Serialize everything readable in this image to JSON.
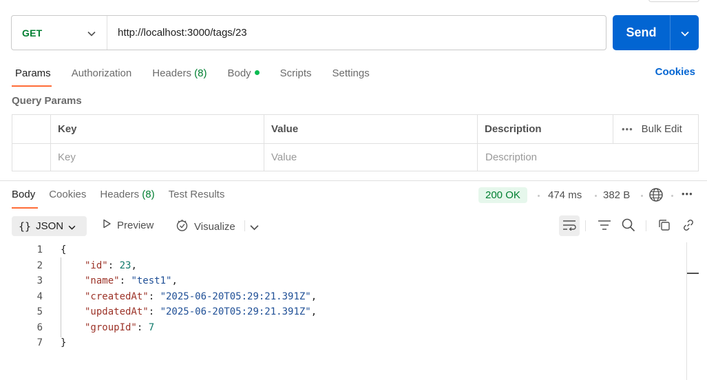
{
  "request": {
    "method": "GET",
    "url": "http://localhost:3000/tags/23",
    "send_label": "Send"
  },
  "request_tabs": {
    "params": "Params",
    "authorization": "Authorization",
    "headers": "Headers",
    "headers_count": "(8)",
    "body": "Body",
    "scripts": "Scripts",
    "settings": "Settings",
    "cookies": "Cookies"
  },
  "query_params": {
    "title": "Query Params",
    "columns": [
      "Key",
      "Value",
      "Description"
    ],
    "bulk_edit": "Bulk Edit",
    "placeholders": {
      "key": "Key",
      "value": "Value",
      "description": "Description"
    }
  },
  "response_tabs": {
    "body": "Body",
    "cookies": "Cookies",
    "headers": "Headers",
    "headers_count": "(8)",
    "test_results": "Test Results"
  },
  "response_meta": {
    "status": "200 OK",
    "time": "474 ms",
    "size": "382 B",
    "more": "•••"
  },
  "response_toolbar": {
    "format_braces": "{}",
    "format": "JSON",
    "preview": "Preview",
    "visualize": "Visualize"
  },
  "response_body": {
    "line_numbers": [
      "1",
      "2",
      "3",
      "4",
      "5",
      "6",
      "7"
    ],
    "open_brace": "{",
    "close_brace": "}",
    "fields": [
      {
        "key": "\"id\"",
        "value": "23",
        "kind": "num",
        "trail": ","
      },
      {
        "key": "\"name\"",
        "value": "\"test1\"",
        "kind": "str",
        "trail": ","
      },
      {
        "key": "\"createdAt\"",
        "value": "\"2025-06-20T05:29:21.391Z\"",
        "kind": "str",
        "trail": ","
      },
      {
        "key": "\"updatedAt\"",
        "value": "\"2025-06-20T05:29:21.391Z\"",
        "kind": "str",
        "trail": ","
      },
      {
        "key": "\"groupId\"",
        "value": "7",
        "kind": "num",
        "trail": ""
      }
    ]
  },
  "colors": {
    "accent_blue": "#0265d2",
    "method_green": "#007f31",
    "tab_orange": "#ff6c37",
    "json_key": "#9c3328",
    "json_string": "#1f4f96",
    "json_number": "#0f7a6b"
  }
}
